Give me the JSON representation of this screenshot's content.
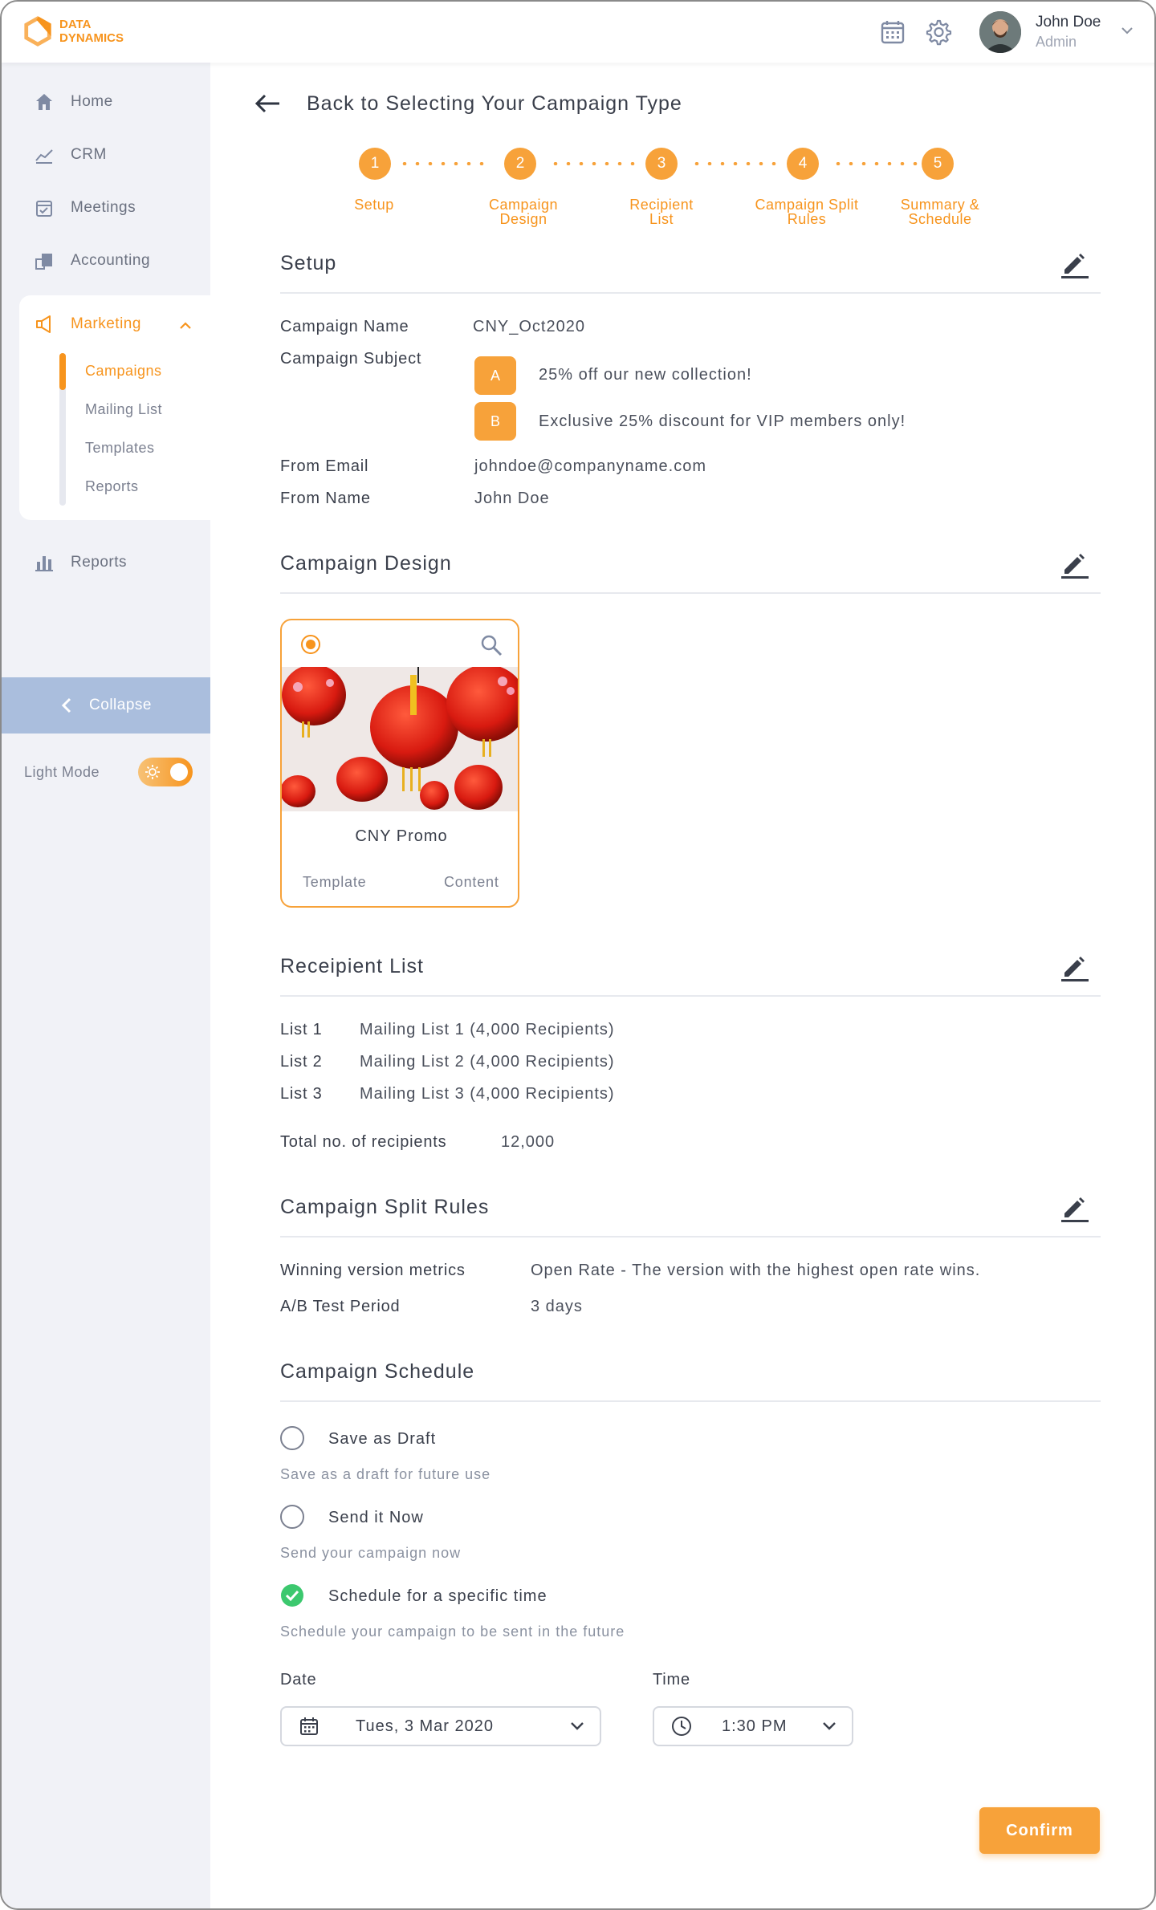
{
  "brand": {
    "logo_line1": "DATA",
    "logo_line2": "DYNAMICS",
    "accent": "#f7941d"
  },
  "header": {
    "calendar_icon": "calendar-icon",
    "settings_icon": "gear-icon",
    "user_name": "John Doe",
    "user_role": "Admin"
  },
  "sidebar": {
    "items": [
      {
        "label": "Home",
        "icon": "home-icon"
      },
      {
        "label": "CRM",
        "icon": "chart-line-icon"
      },
      {
        "label": "Meetings",
        "icon": "calendar-check-icon"
      },
      {
        "label": "Accounting",
        "icon": "accounting-icon"
      },
      {
        "label": "Reports",
        "icon": "bar-chart-icon"
      }
    ],
    "marketing": {
      "label": "Marketing",
      "submenu": [
        "Campaigns",
        "Mailing List",
        "Templates",
        "Reports"
      ],
      "active": "Campaigns"
    },
    "collapse_label": "Collapse",
    "light_mode_label": "Light Mode",
    "light_mode_on": true
  },
  "back": {
    "label": "Back to Selecting Your Campaign Type"
  },
  "steps": [
    {
      "num": "1",
      "line1": "Setup",
      "line2": ""
    },
    {
      "num": "2",
      "line1": "Campaign",
      "line2": "Design"
    },
    {
      "num": "3",
      "line1": "Recipient",
      "line2": "List"
    },
    {
      "num": "4",
      "line1": "Campaign Split",
      "line2": "Rules"
    },
    {
      "num": "5",
      "line1": "Summary &",
      "line2": "Schedule"
    }
  ],
  "setup": {
    "title": "Setup",
    "campaign_name_label": "Campaign Name",
    "campaign_name": "CNY_Oct2020",
    "campaign_subject_label": "Campaign Subject",
    "subjects": [
      {
        "badge": "A",
        "text": "25% off our new collection!"
      },
      {
        "badge": "B",
        "text": "Exclusive 25% discount for VIP members only!"
      }
    ],
    "from_email_label": "From Email",
    "from_email": "johndoe@companyname.com",
    "from_name_label": "From Name",
    "from_name": "John Doe"
  },
  "design": {
    "title": "Campaign Design",
    "card_title": "CNY Promo",
    "tab_template": "Template",
    "tab_content": "Content"
  },
  "recipients": {
    "title": "Receipient List",
    "lists": [
      {
        "label": "List 1",
        "value": "Mailing List 1 (4,000 Recipients)"
      },
      {
        "label": "List 2",
        "value": "Mailing List 2 (4,000 Recipients)"
      },
      {
        "label": "List 3",
        "value": "Mailing List 3 (4,000 Recipients)"
      }
    ],
    "total_label": "Total no. of recipients",
    "total_value": "12,000"
  },
  "split": {
    "title": "Campaign Split Rules",
    "metrics_label": "Winning version metrics",
    "metrics_value": "Open Rate - The version with the highest open rate wins.",
    "period_label": "A/B Test Period",
    "period_value": "3 days"
  },
  "schedule": {
    "title": "Campaign Schedule",
    "options": [
      {
        "label": "Save as Draft",
        "desc": "Save as a draft for future use",
        "checked": false
      },
      {
        "label": "Send it Now",
        "desc": "Send your campaign now",
        "checked": false
      },
      {
        "label": "Schedule for a specific time",
        "desc": "Schedule your campaign to be sent in the future",
        "checked": true
      }
    ],
    "date_label": "Date",
    "date_value": "Tues, 3 Mar 2020",
    "time_label": "Time",
    "time_value": "1:30 PM"
  },
  "confirm_label": "Confirm"
}
